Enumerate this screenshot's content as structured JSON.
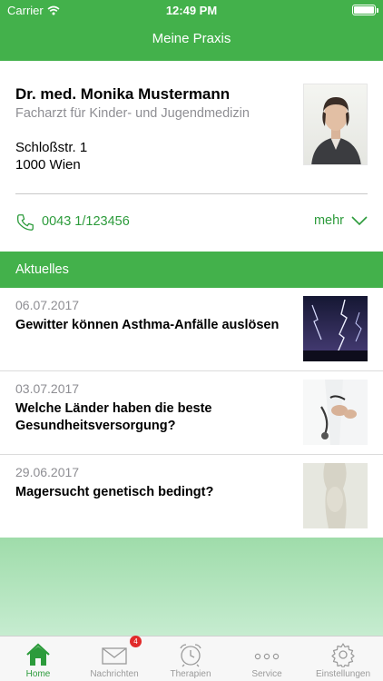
{
  "status_bar": {
    "carrier": "Carrier",
    "time": "12:49 PM"
  },
  "nav": {
    "title": "Meine Praxis"
  },
  "doctor": {
    "name": "Dr. med. Monika Mustermann",
    "specialty": "Facharzt für Kinder- und Jugendmedizin",
    "street": "Schloßstr. 1",
    "city": "1000 Wien",
    "phone": "0043 1/123456",
    "more_label": "mehr"
  },
  "section": {
    "title": "Aktuelles"
  },
  "news": [
    {
      "date": "06.07.2017",
      "title": "Gewitter können Asthma-Anfälle auslösen"
    },
    {
      "date": "03.07.2017",
      "title": "Welche Länder haben die beste Gesundheitsversorgung?"
    },
    {
      "date": "29.06.2017",
      "title": "Magersucht genetisch bedingt?"
    }
  ],
  "tabbar": {
    "tabs": [
      {
        "label": "Home",
        "icon": "home-icon",
        "active": true
      },
      {
        "label": "Nachrichten",
        "icon": "envelope-icon"
      },
      {
        "label": "Therapien",
        "icon": "alarm-clock-icon"
      },
      {
        "label": "Service",
        "icon": "more-dots-icon"
      },
      {
        "label": "Einstellungen",
        "icon": "gear-icon"
      }
    ],
    "messages_badge": "4"
  },
  "colors": {
    "brand_green": "#43b14b",
    "link_green": "#2c9b3b",
    "badge_red": "#e12b2b"
  }
}
